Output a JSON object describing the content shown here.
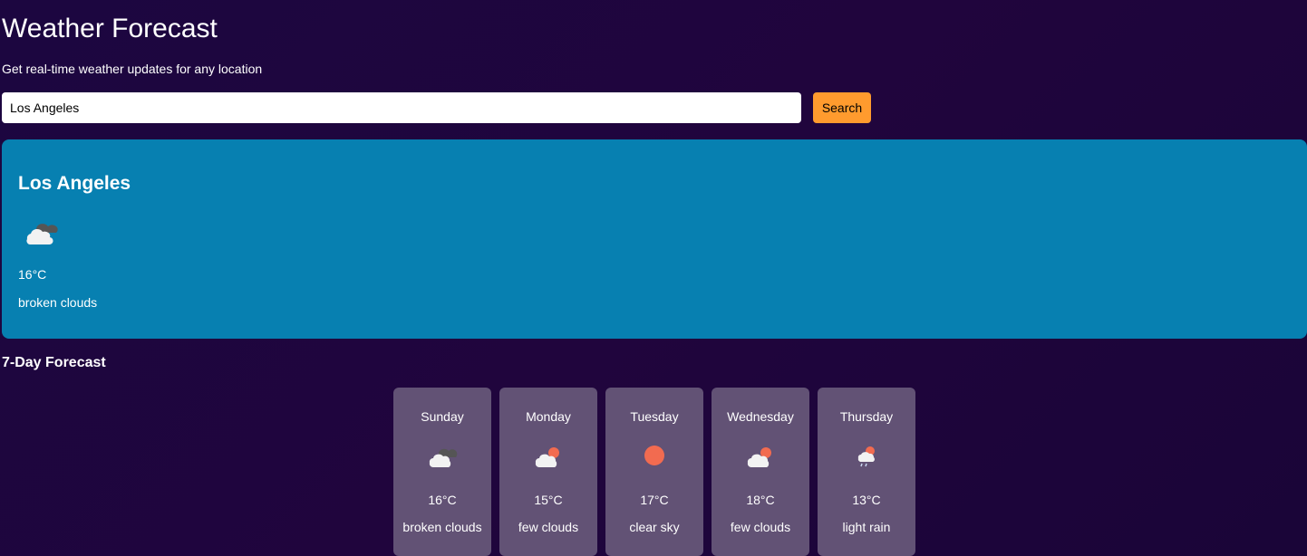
{
  "header": {
    "title": "Weather Forecast",
    "subtitle": "Get real-time weather updates for any location"
  },
  "search": {
    "value": "Los Angeles",
    "button_label": "Search"
  },
  "current": {
    "city": "Los Angeles",
    "icon": "broken-clouds-icon",
    "temperature": "16°C",
    "description": "broken clouds"
  },
  "forecast": {
    "heading": "7-Day Forecast",
    "days": [
      {
        "day": "Sunday",
        "icon": "broken-clouds-icon",
        "temperature": "16°C",
        "description": "broken clouds"
      },
      {
        "day": "Monday",
        "icon": "few-clouds-icon",
        "temperature": "15°C",
        "description": "few clouds"
      },
      {
        "day": "Tuesday",
        "icon": "clear-sky-icon",
        "temperature": "17°C",
        "description": "clear sky"
      },
      {
        "day": "Wednesday",
        "icon": "few-clouds-icon",
        "temperature": "18°C",
        "description": "few clouds"
      },
      {
        "day": "Thursday",
        "icon": "light-rain-icon",
        "temperature": "13°C",
        "description": "light rain"
      }
    ]
  },
  "colors": {
    "background": "#1e0640",
    "accent_button": "#ff9b2e",
    "current_card": "#0780b1",
    "forecast_card": "#625275",
    "sun": "#f26b50"
  }
}
